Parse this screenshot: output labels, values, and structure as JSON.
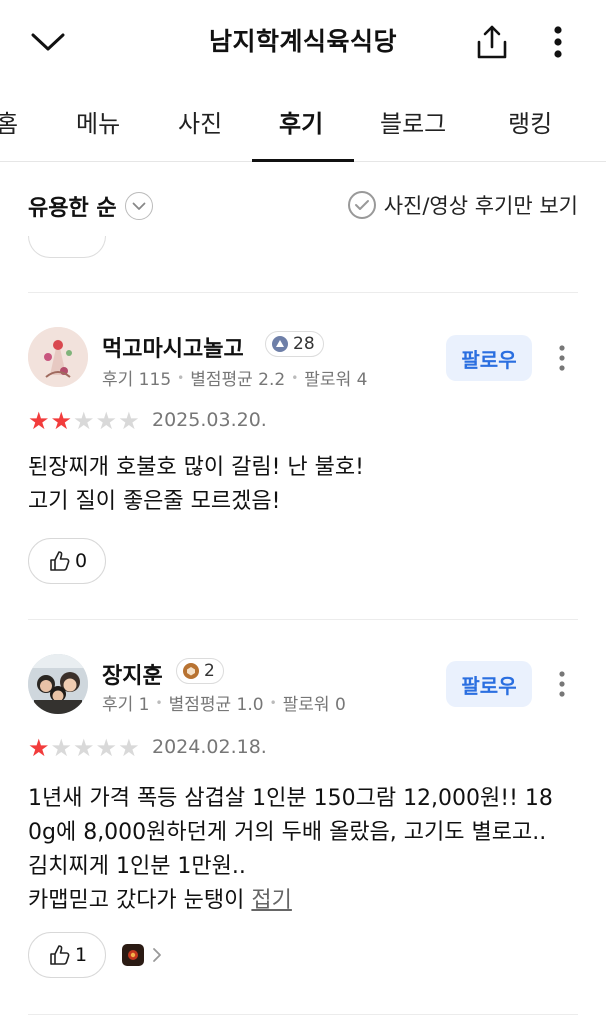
{
  "header": {
    "title": "남지학계식육식당",
    "back_icon": "chevron-down-icon",
    "share_icon": "share-icon",
    "more_icon": "more-vertical-icon"
  },
  "tabs": [
    {
      "label": "홈"
    },
    {
      "label": "메뉴"
    },
    {
      "label": "사진"
    },
    {
      "label": "후기",
      "active": true
    },
    {
      "label": "블로그"
    },
    {
      "label": "랭킹"
    }
  ],
  "filter": {
    "sort_label": "유용한 순",
    "photo_only_label": "사진/영상 후기만 보기"
  },
  "reviews": [
    {
      "username": "먹고마시고놀고",
      "level": "28",
      "stats": {
        "reviews": "후기 115",
        "avg": "별점평균 2.2",
        "followers": "팔로워 4"
      },
      "follow_label": "팔로우",
      "rating": 2,
      "date": "2025.03.20.",
      "text_lines": [
        "된장찌개 호불호 많이 갈림! 난 불호!",
        "고기 질이 좋은줄 모르겠음!"
      ],
      "likes": "0"
    },
    {
      "username": "장지훈",
      "level": "2",
      "stats": {
        "reviews": "후기 1",
        "avg": "별점평균 1.0",
        "followers": "팔로워 0"
      },
      "follow_label": "팔로우",
      "rating": 1,
      "date": "2024.02.18.",
      "text_lines": [
        "1년새 가격 폭등 삼겹살 1인분 150그람 12,000원!! 18",
        "0g에 8,000원하던게 거의 두배 올랐음, 고기도 별로고..",
        "김치찌게 1인분 1만원..",
        "카맵믿고 갔다가 눈탱이"
      ],
      "fold_label": "접기",
      "likes": "1"
    }
  ],
  "colors": {
    "accent_blue": "#2b6fe0",
    "follow_bg": "#eaf1fd",
    "star_red": "#f23c3c",
    "star_gray": "#d9d9d9"
  }
}
